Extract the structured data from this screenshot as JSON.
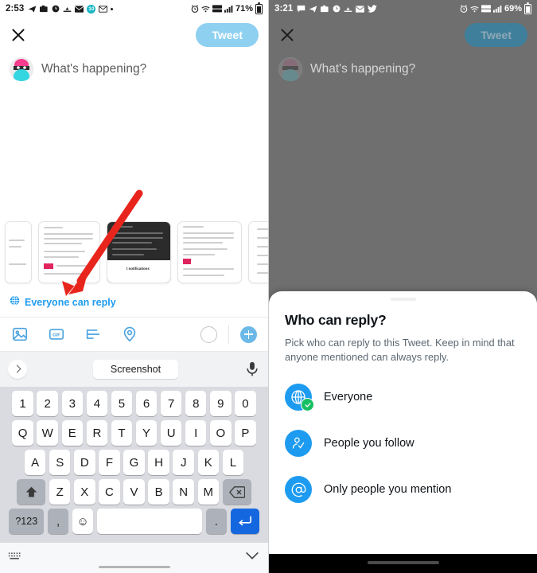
{
  "left_phone": {
    "status_bar": {
      "time": "2:53",
      "battery": "71%",
      "icons": [
        "telegram-icon",
        "camera-icon",
        "clock-icon",
        "download-icon",
        "mail-icon",
        "badge-10-icon",
        "envelope-icon",
        "dot-icon"
      ],
      "right_icons": [
        "alarm-icon",
        "wifi-icon",
        "volte-icon",
        "signal-icon"
      ],
      "badge_count": "10"
    },
    "header": {
      "close_label": "close",
      "tweet_label": "Tweet"
    },
    "composer": {
      "placeholder": "What's happening?"
    },
    "scope": {
      "label": "Everyone can reply",
      "icon": "globe-icon"
    },
    "toolbar": {
      "icons": [
        "image-icon",
        "gif-icon",
        "poll-icon",
        "location-icon"
      ],
      "gif_label": "GIF",
      "plus_label": "+"
    },
    "keyboard": {
      "suggestion": "Screenshot",
      "mic_label": "microphone",
      "row_numbers": [
        "1",
        "2",
        "3",
        "4",
        "5",
        "6",
        "7",
        "8",
        "9",
        "0"
      ],
      "row_top": [
        "Q",
        "W",
        "E",
        "R",
        "T",
        "Y",
        "U",
        "I",
        "O",
        "P"
      ],
      "row_home": [
        "A",
        "S",
        "D",
        "F",
        "G",
        "H",
        "J",
        "K",
        "L"
      ],
      "row_bottom": [
        "Z",
        "X",
        "C",
        "V",
        "B",
        "N",
        "M"
      ],
      "shift_label": "shift",
      "backspace_label": "backspace",
      "symbols_label": "?123",
      "comma_label": ",",
      "emoji_label": "☺",
      "space_label": "",
      "period_label": ".",
      "enter_label": "enter"
    }
  },
  "right_phone": {
    "status_bar": {
      "time": "3:21",
      "battery": "69%",
      "icons": [
        "chat-icon",
        "telegram-icon",
        "camera-icon",
        "clock-icon",
        "download-icon",
        "mail-icon",
        "twitter-icon"
      ],
      "right_icons": [
        "alarm-icon",
        "wifi-icon",
        "volte-icon",
        "signal-icon"
      ]
    },
    "header": {
      "close_label": "close",
      "tweet_label": "Tweet"
    },
    "composer": {
      "placeholder": "What's happening?"
    },
    "sheet": {
      "title": "Who can reply?",
      "subtitle": "Pick who can reply to this Tweet. Keep in mind that anyone mentioned can always reply.",
      "options": [
        {
          "label": "Everyone",
          "icon": "globe-icon",
          "selected": true
        },
        {
          "label": "People you follow",
          "icon": "person-check-icon",
          "selected": false
        },
        {
          "label": "Only people you mention",
          "icon": "at-sign-icon",
          "selected": false
        }
      ]
    }
  },
  "annotation": {
    "arrow_color": "#e8251c",
    "arrow_name": "red-pointer-arrow"
  },
  "colors": {
    "twitter_blue": "#1d9bf0",
    "tweet_btn_light": "#8ed0f0",
    "green_check": "#17bf63",
    "dim_overlay": "#6f6f6f",
    "enter_key_blue": "#1567e0"
  }
}
